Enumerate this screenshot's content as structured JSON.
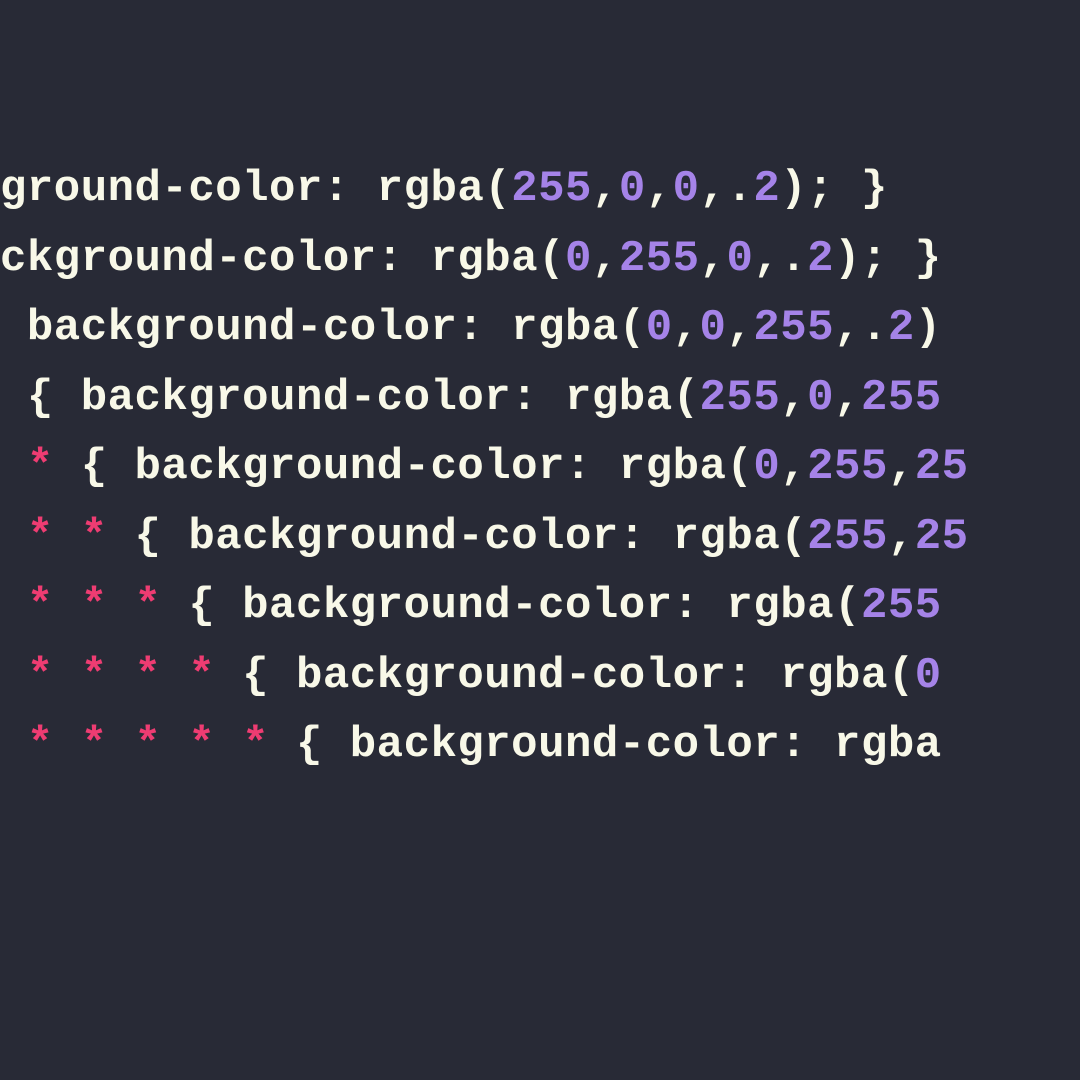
{
  "code": {
    "lines": [
      {
        "tokens": [
          {
            "t": "default",
            "v": "ground-color: rgba("
          },
          {
            "t": "number",
            "v": "255"
          },
          {
            "t": "default",
            "v": ","
          },
          {
            "t": "number",
            "v": "0"
          },
          {
            "t": "default",
            "v": ","
          },
          {
            "t": "number",
            "v": "0"
          },
          {
            "t": "default",
            "v": ",."
          },
          {
            "t": "number",
            "v": "2"
          },
          {
            "t": "default",
            "v": "); }"
          }
        ]
      },
      {
        "tokens": [
          {
            "t": "default",
            "v": "ckground-color: rgba("
          },
          {
            "t": "number",
            "v": "0"
          },
          {
            "t": "default",
            "v": ","
          },
          {
            "t": "number",
            "v": "255"
          },
          {
            "t": "default",
            "v": ","
          },
          {
            "t": "number",
            "v": "0"
          },
          {
            "t": "default",
            "v": ",."
          },
          {
            "t": "number",
            "v": "2"
          },
          {
            "t": "default",
            "v": "); }"
          }
        ]
      },
      {
        "tokens": [
          {
            "t": "default",
            "v": " background-color: rgba("
          },
          {
            "t": "number",
            "v": "0"
          },
          {
            "t": "default",
            "v": ","
          },
          {
            "t": "number",
            "v": "0"
          },
          {
            "t": "default",
            "v": ","
          },
          {
            "t": "number",
            "v": "255"
          },
          {
            "t": "default",
            "v": ",."
          },
          {
            "t": "number",
            "v": "2"
          },
          {
            "t": "default",
            "v": ")"
          }
        ]
      },
      {
        "tokens": [
          {
            "t": "default",
            "v": " { background-color: rgba("
          },
          {
            "t": "number",
            "v": "255"
          },
          {
            "t": "default",
            "v": ","
          },
          {
            "t": "number",
            "v": "0"
          },
          {
            "t": "default",
            "v": ","
          },
          {
            "t": "number",
            "v": "255"
          }
        ]
      },
      {
        "tokens": [
          {
            "t": "selector",
            "v": " *"
          },
          {
            "t": "default",
            "v": " { background-color: rgba("
          },
          {
            "t": "number",
            "v": "0"
          },
          {
            "t": "default",
            "v": ","
          },
          {
            "t": "number",
            "v": "255"
          },
          {
            "t": "default",
            "v": ","
          },
          {
            "t": "number",
            "v": "25"
          }
        ]
      },
      {
        "tokens": [
          {
            "t": "selector",
            "v": " * *"
          },
          {
            "t": "default",
            "v": " { background-color: rgba("
          },
          {
            "t": "number",
            "v": "255"
          },
          {
            "t": "default",
            "v": ","
          },
          {
            "t": "number",
            "v": "25"
          }
        ]
      },
      {
        "tokens": [
          {
            "t": "selector",
            "v": " * * *"
          },
          {
            "t": "default",
            "v": " { background-color: rgba("
          },
          {
            "t": "number",
            "v": "255"
          }
        ]
      },
      {
        "tokens": [
          {
            "t": "selector",
            "v": " * * * *"
          },
          {
            "t": "default",
            "v": " { background-color: rgba("
          },
          {
            "t": "number",
            "v": "0"
          }
        ]
      },
      {
        "tokens": [
          {
            "t": "selector",
            "v": " * * * * *"
          },
          {
            "t": "default",
            "v": " { background-color: rgba"
          }
        ]
      }
    ]
  },
  "syntax_colors": {
    "background": "#282a36",
    "default": "#f8f8e8",
    "number": "#a583e8",
    "selector": "#ee3c72"
  }
}
